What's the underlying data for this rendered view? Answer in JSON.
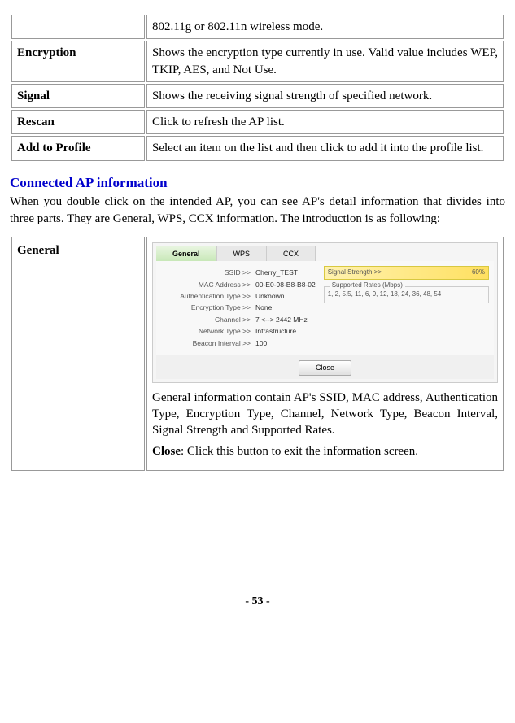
{
  "def_table": {
    "row_mode_desc": "802.11g or 802.11n wireless mode.",
    "rows": [
      {
        "label": "Encryption",
        "desc": "Shows the encryption type currently in use. Valid value includes WEP, TKIP, AES, and Not Use."
      },
      {
        "label": "Signal",
        "desc": "Shows the receiving signal strength of specified network."
      },
      {
        "label": "Rescan",
        "desc": "Click to refresh the AP list."
      },
      {
        "label": "Add to Profile",
        "desc": "Select an item on the list and then click to add it into the profile list."
      }
    ]
  },
  "section": {
    "heading": "Connected AP information",
    "para": "When you double click on the intended AP, you can see AP's detail information that divides into three parts. They are General, WPS, CCX information. The introduction is as following:"
  },
  "general": {
    "label": "General",
    "tabs": {
      "general": "General",
      "wps": "WPS",
      "ccx": "CCX"
    },
    "kv": {
      "ssid_k": "SSID >>",
      "ssid_v": "Cherry_TEST",
      "mac_k": "MAC Address >>",
      "mac_v": "00-E0-98-B8-B8-02",
      "auth_k": "Authentication Type >>",
      "auth_v": "Unknown",
      "enc_k": "Encryption Type >>",
      "enc_v": "None",
      "chan_k": "Channel >>",
      "chan_v": "7 <--> 2442 MHz",
      "net_k": "Network Type >>",
      "net_v": "Infrastructure",
      "beacon_k": "Beacon Interval >>",
      "beacon_v": "100"
    },
    "signal": {
      "label": "Signal Strength >>",
      "value": "60%"
    },
    "rates": {
      "title": "Supported Rates (Mbps)",
      "list": "1, 2, 5.5, 11, 6, 9, 12, 18, 24, 36, 48, 54"
    },
    "close": "Close",
    "desc": "General information contain AP's SSID, MAC address, Authentication Type, Encryption Type, Channel, Network Type, Beacon Interval, Signal Strength and Supported Rates.",
    "close_label": "Close",
    "close_desc": ": Click this button to exit the information screen."
  },
  "page_num": "- 53 -"
}
